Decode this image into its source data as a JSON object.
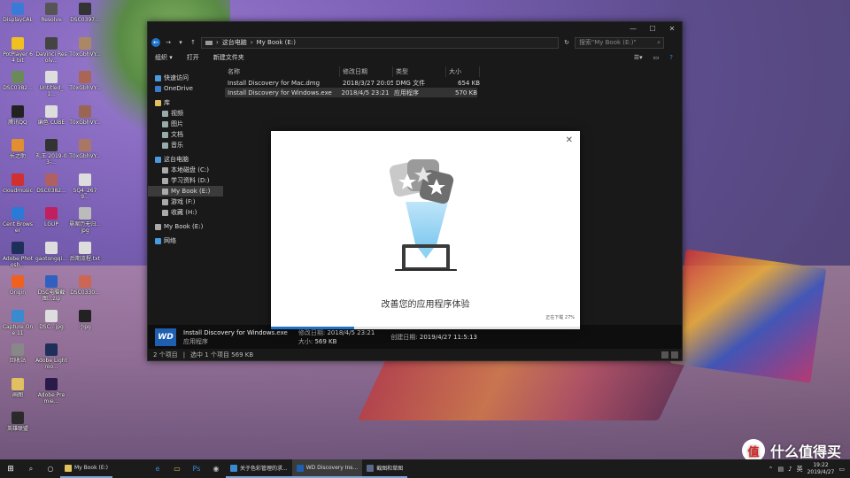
{
  "desktop": {
    "icons": [
      {
        "label": "DisplayCAL",
        "color": "#3b7bd8"
      },
      {
        "label": "PotPlayer 64 bit",
        "color": "#f0c020"
      },
      {
        "label": "DSC0382...",
        "color": "#6a8a5a"
      },
      {
        "label": "腾讯QQ",
        "color": "#222222"
      },
      {
        "label": "长之助",
        "color": "#e09030"
      },
      {
        "label": "cloudmusic",
        "color": "#d03030"
      },
      {
        "label": "Cent Browser",
        "color": "#2a7ad8"
      },
      {
        "label": "Adobe Photosh...",
        "color": "#1e2f5a"
      },
      {
        "label": "Origin",
        "color": "#f06020"
      },
      {
        "label": "Capture One 11",
        "color": "#3a8ad0"
      },
      {
        "label": "回收站",
        "color": "#888888"
      },
      {
        "label": "画图",
        "color": "#e0c060"
      },
      {
        "label": "英雄联盟",
        "color": "#2a2a2a"
      },
      {
        "label": "Resolve",
        "color": "#555555"
      },
      {
        "label": "DaVinci Resolv...",
        "color": "#444444"
      },
      {
        "label": "Untitled_1...",
        "color": "#dddddd"
      },
      {
        "label": "编色 CUBE",
        "color": "#dddddd"
      },
      {
        "label": "礼王 2019-03-...",
        "color": "#333333"
      },
      {
        "label": "DSC0382...",
        "color": "#b06060"
      },
      {
        "label": "LGUP",
        "color": "#c02060"
      },
      {
        "label": "gaotongqi...",
        "color": "#dddddd"
      },
      {
        "label": "DSC电脑截图...zip",
        "color": "#3060c0"
      },
      {
        "label": "DSC...jpg",
        "color": "#dddddd"
      },
      {
        "label": "Adobe Lightroo...",
        "color": "#1e2f5a"
      },
      {
        "label": "Adobe Premie...",
        "color": "#2a1a4a"
      },
      {
        "label": "DSC0397...",
        "color": "#333333"
      },
      {
        "label": "T0xGbhVY...",
        "color": "#aa8866"
      },
      {
        "label": "T0xGbhVY...",
        "color": "#aa6655"
      },
      {
        "label": "T0xGbhVY...",
        "color": "#996655"
      },
      {
        "label": "T0xGbhVY...",
        "color": "#aa7766"
      },
      {
        "label": "5Q4_2679...",
        "color": "#dddddd"
      },
      {
        "label": "悬案历无归...jpg",
        "color": "#bbbbbb"
      },
      {
        "label": "后期流程.txt",
        "color": "#dddddd"
      },
      {
        "label": "DSC0330...",
        "color": "#cc6655"
      },
      {
        "label": "小pg",
        "color": "#222222"
      }
    ]
  },
  "explorer": {
    "title_controls": {
      "minimize": "—",
      "maximize": "☐",
      "close": "✕"
    },
    "address": {
      "crumbs": [
        "这台电脑",
        "My Book (E:)"
      ],
      "separator": "›"
    },
    "search_placeholder": "搜索\"My Book (E:)\"",
    "toolbar": {
      "organize": "组织 ▾",
      "open": "打开",
      "new_folder": "新建文件夹"
    },
    "nav": [
      {
        "label": "快速访问",
        "color": "#4a9ae0",
        "indent": 0
      },
      {
        "label": "OneDrive",
        "color": "#3a7ad0",
        "indent": 0
      },
      {
        "label": "库",
        "color": "#e0c060",
        "indent": 0
      },
      {
        "label": "视频",
        "color": "#9aa",
        "indent": 1
      },
      {
        "label": "图片",
        "color": "#9aa",
        "indent": 1
      },
      {
        "label": "文档",
        "color": "#9aa",
        "indent": 1
      },
      {
        "label": "音乐",
        "color": "#9aa",
        "indent": 1
      },
      {
        "label": "这台电脑",
        "color": "#4a9ae0",
        "indent": 0
      },
      {
        "label": "本地磁盘 (C:)",
        "color": "#aaa",
        "indent": 1
      },
      {
        "label": "学习资料 (D:)",
        "color": "#aaa",
        "indent": 1
      },
      {
        "label": "My Book (E:)",
        "color": "#aaa",
        "indent": 1,
        "selected": true
      },
      {
        "label": "游戏 (F:)",
        "color": "#aaa",
        "indent": 1
      },
      {
        "label": "收藏 (H:)",
        "color": "#aaa",
        "indent": 1
      },
      {
        "label": "My Book (E:)",
        "color": "#aaa",
        "indent": 0
      },
      {
        "label": "网络",
        "color": "#4a9ae0",
        "indent": 0
      }
    ],
    "columns": {
      "name": "名称",
      "modified": "修改日期",
      "type": "类型",
      "size": "大小"
    },
    "files": [
      {
        "name": "Install Discovery for Mac.dmg",
        "modified": "2018/3/27 20:05",
        "type": "DMG 文件",
        "size": "654 KB",
        "selected": false
      },
      {
        "name": "Install Discovery for Windows.exe",
        "modified": "2018/4/5 23:21",
        "type": "应用程序",
        "size": "570 KB",
        "selected": true
      }
    ],
    "details": {
      "filename": "Install Discovery for Windows.exe",
      "type": "应用程序",
      "modified_label": "修改日期:",
      "modified": "2018/4/5 23:21",
      "created_label": "创建日期:",
      "created": "2019/4/27 11:5:13",
      "size_label": "大小:",
      "size": "569 KB",
      "logo": "WD"
    },
    "status": {
      "items": "2 个项目",
      "selected": "选中 1 个项目  569 KB"
    }
  },
  "installer": {
    "close": "✕",
    "title": "改善您的应用程序体验",
    "status": "正在下载 27%",
    "progress": 0.27
  },
  "taskbar": {
    "start_glyph": "⊞",
    "windows": [
      {
        "label": "My Book (E:)",
        "color": "#e0c060",
        "state": "open"
      },
      {
        "label": "关于色彩管理的求...",
        "color": "#3a8ad0",
        "state": "open"
      },
      {
        "label": "WD Discovery Ins...",
        "color": "#1e5fb0",
        "state": "active"
      },
      {
        "label": "截图和草图",
        "color": "#5a6a8a",
        "state": "open"
      }
    ],
    "tray": {
      "lang": "英",
      "time": "19:22",
      "date": "2019/4/27"
    }
  },
  "watermark": {
    "text": "什么值得买",
    "badge": "值"
  }
}
